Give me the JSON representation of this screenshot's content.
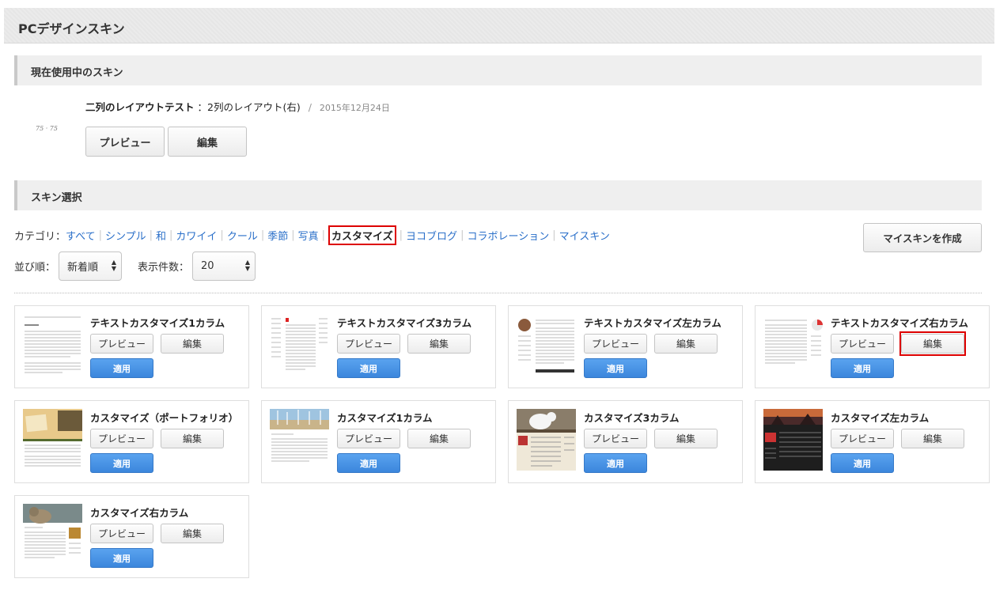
{
  "header": {
    "title": "PCデザインスキン"
  },
  "current": {
    "section_title": "現在使用中のスキン",
    "skin_name": "二列のレイアウトテスト",
    "layout": "：2列のレイアウト(右)",
    "separator": "/",
    "date": "2015年12月24日",
    "preview_label": "プレビュー",
    "edit_label": "編集"
  },
  "select_section": {
    "title": "スキン選択",
    "category_label": "カテゴリ：",
    "categories": [
      "すべて",
      "シンプル",
      "和",
      "カワイイ",
      "クール",
      "季節",
      "写真",
      "カスタマイズ",
      "ヨコブログ",
      "コラボレーション",
      "マイスキン"
    ],
    "active_category": "カスタマイズ",
    "create_button": "マイスキンを作成",
    "sort_label": "並び順：",
    "sort_value": "新着順",
    "count_label": "表示件数：",
    "count_value": "20"
  },
  "skins": [
    {
      "title": "テキストカスタマイズ1カラム",
      "preview": "プレビュー",
      "edit": "編集",
      "apply": "適用"
    },
    {
      "title": "テキストカスタマイズ3カラム",
      "preview": "プレビュー",
      "edit": "編集",
      "apply": "適用"
    },
    {
      "title": "テキストカスタマイズ左カラム",
      "preview": "プレビュー",
      "edit": "編集",
      "apply": "適用"
    },
    {
      "title": "テキストカスタマイズ右カラム",
      "preview": "プレビュー",
      "edit": "編集",
      "apply": "適用"
    },
    {
      "title": "カスタマイズ（ポートフォリオ）",
      "preview": "プレビュー",
      "edit": "編集",
      "apply": "適用"
    },
    {
      "title": "カスタマイズ1カラム",
      "preview": "プレビュー",
      "edit": "編集",
      "apply": "適用"
    },
    {
      "title": "カスタマイズ3カラム",
      "preview": "プレビュー",
      "edit": "編集",
      "apply": "適用"
    },
    {
      "title": "カスタマイズ左カラム",
      "preview": "プレビュー",
      "edit": "編集",
      "apply": "適用"
    },
    {
      "title": "カスタマイズ右カラム",
      "preview": "プレビュー",
      "edit": "編集",
      "apply": "適用"
    }
  ]
}
